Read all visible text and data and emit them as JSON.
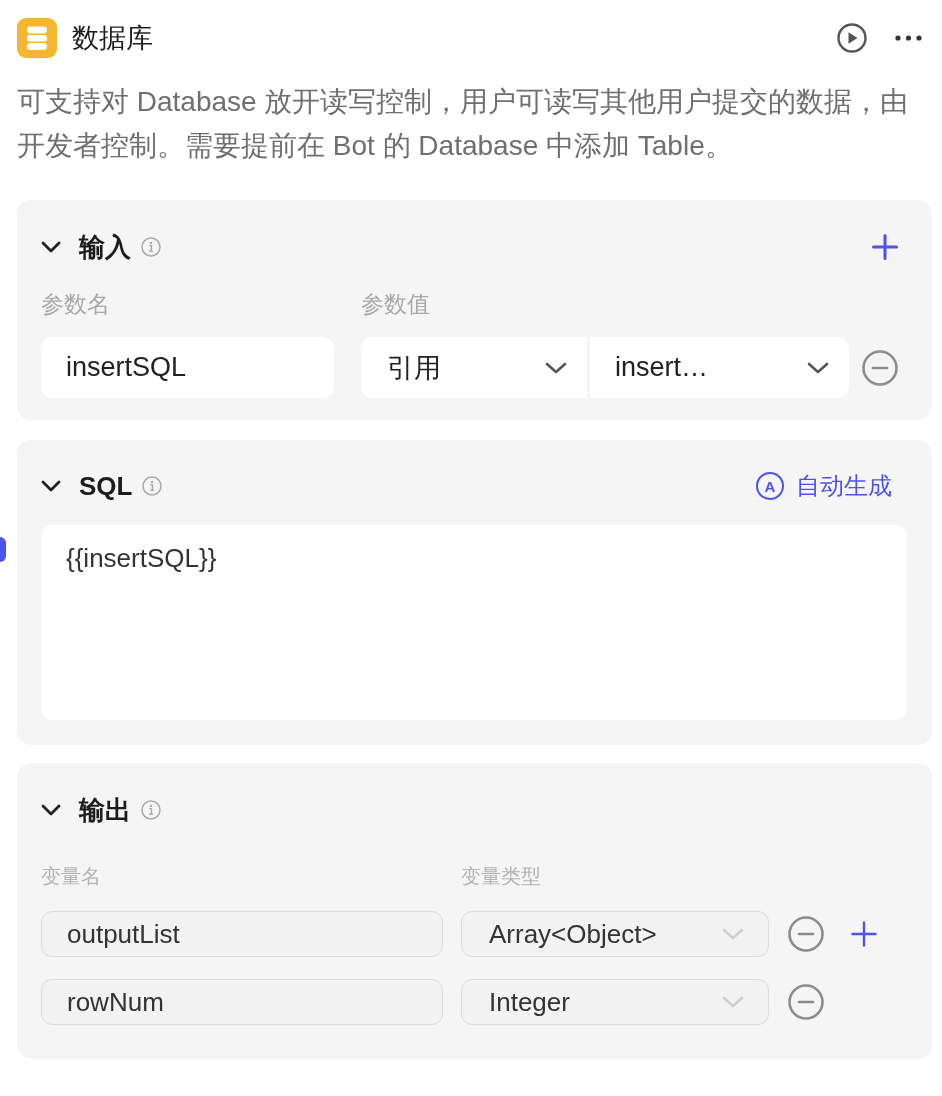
{
  "node": {
    "title": "数据库",
    "description": "可支持对 Database 放开读写控制，用户可读写其他用户提交的数据，由开发者控制。需要提前在 Bot 的 Database 中添加 Table。"
  },
  "input": {
    "title": "输入",
    "expanded": true,
    "columns": [
      "参数名",
      "参数值"
    ],
    "params": [
      {
        "name": "insertSQL",
        "source": "引用",
        "value": "insert…"
      }
    ]
  },
  "sql": {
    "title": "SQL",
    "expanded": true,
    "action_icon": "A",
    "action": "自动生成",
    "value": "{{insertSQL}}"
  },
  "output": {
    "title": "输出",
    "expanded": true,
    "columns": [
      "变量名",
      "变量类型"
    ],
    "variables": [
      {
        "name": "outputList",
        "type": "Array<Object>",
        "disabled": true
      },
      {
        "name": "rowNum",
        "type": "Integer",
        "disabled": true
      }
    ]
  }
}
